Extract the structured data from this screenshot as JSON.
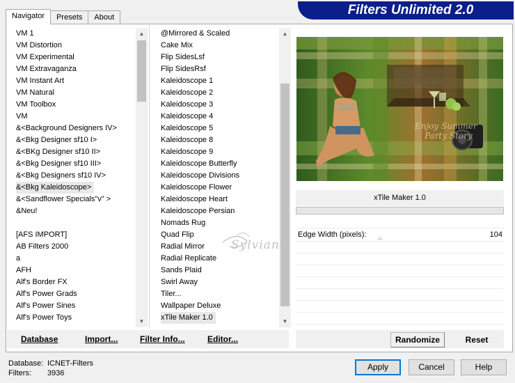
{
  "tabs": [
    "Navigator",
    "Presets",
    "About"
  ],
  "title": "Filters Unlimited 2.0",
  "categories": [
    "VM 1",
    "VM Distortion",
    "VM Experimental",
    "VM Extravaganza",
    "VM Instant Art",
    "VM Natural",
    "VM Toolbox",
    "VM",
    "&<Background Designers IV>",
    "&<Bkg Designer sf10 I>",
    "&<BKg Designer sf10 II>",
    "&<Bkg Designer sf10 III>",
    "&<Bkg Designers sf10 IV>",
    "&<Bkg Kaleidoscope>",
    "&<Sandflower Specials\"v\" >",
    "&Neu!",
    "",
    "[AFS IMPORT]",
    "AB Filters 2000",
    "a",
    "AFH",
    "Alf's Border FX",
    "Alf's Power Grads",
    "Alf's Power Sines",
    "Alf's Power Toys"
  ],
  "filters": [
    "@Mirrored & Scaled",
    "Cake Mix",
    "Flip SidesLsf",
    "Flip SidesRsf",
    "Kaleidoscope 1",
    "Kaleidoscope 2",
    "Kaleidoscope 3",
    "Kaleidoscope 4",
    "Kaleidoscope 5",
    "Kaleidoscope 8",
    "Kaleidoscope 9",
    "Kaleidoscope Butterfly",
    "Kaleidoscope Divisions",
    "Kaleidoscope Flower",
    "Kaleidoscope Heart",
    "Kaleidoscope Persian",
    "Nomads Rug",
    "Quad Flip",
    "Radial Mirror",
    "Radial Replicate",
    "Sands Plaid",
    "Swirl Away",
    "Tiler...",
    "Wallpaper Deluxe",
    "xTile Maker 1.0"
  ],
  "selected_category": "&<Bkg Kaleidoscope>",
  "selected_filter": "xTile Maker 1.0",
  "preview": {
    "watermark": "Sylviane",
    "text_line1": "Enjoy Summer",
    "text_line2": "Party Story"
  },
  "filter_name": "xTile Maker 1.0",
  "param": {
    "label": "Edge Width (pixels):",
    "value": "104"
  },
  "bottom_left": {
    "database": "Database",
    "import": "Import...",
    "filter_info": "Filter Info...",
    "editor": "Editor..."
  },
  "bottom_right": {
    "randomize": "Randomize",
    "reset": "Reset"
  },
  "status": {
    "db_label": "Database:",
    "db_value": "ICNET-Filters",
    "filters_label": "Filters:",
    "filters_value": "3936"
  },
  "buttons": {
    "apply": "Apply",
    "cancel": "Cancel",
    "help": "Help"
  },
  "colors": {
    "title_bg": "#0b1e8a",
    "default_btn_border": "#0078d7"
  }
}
